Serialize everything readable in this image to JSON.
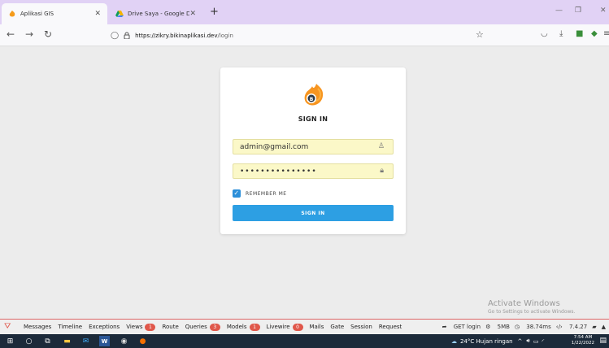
{
  "browser": {
    "tabs": [
      {
        "title": "Aplikasi GIS",
        "active": true
      },
      {
        "title": "Drive Saya - Google Drive",
        "active": false
      }
    ],
    "new_tab": "+",
    "url_host": "https://zikry.bikinaplikasi.dev",
    "url_path": "/login"
  },
  "login": {
    "title": "SIGN IN",
    "email_value": "admin@gmail.com",
    "password_value": "•••••••••••••••",
    "remember_label": "REMEMBER ME",
    "remember_checked": true,
    "submit_label": "SIGN IN",
    "accent_color": "#2d9fe3"
  },
  "watermark": {
    "line1": "Activate Windows",
    "line2": "Go to Settings to activate Windows."
  },
  "debugbar": {
    "tabs": [
      {
        "label": "Messages"
      },
      {
        "label": "Timeline"
      },
      {
        "label": "Exceptions"
      },
      {
        "label": "Views",
        "badge": "1"
      },
      {
        "label": "Route"
      },
      {
        "label": "Queries",
        "badge": "3"
      },
      {
        "label": "Models",
        "badge": "1"
      },
      {
        "label": "Livewire",
        "badge": "0"
      },
      {
        "label": "Mails"
      },
      {
        "label": "Gate"
      },
      {
        "label": "Session"
      },
      {
        "label": "Request"
      }
    ],
    "route": "GET login",
    "memory": "5MB",
    "duration": "38.74ms",
    "php_version": "7.4.27"
  },
  "taskbar": {
    "weather": "24°C  Hujan ringan",
    "time": "7:54 AM",
    "date": "1/22/2022"
  }
}
